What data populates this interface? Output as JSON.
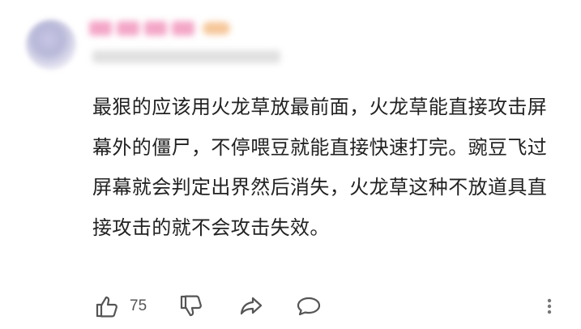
{
  "comment": {
    "text": "最狠的应该用火龙草放最前面，火龙草能直接攻击屏幕外的僵尸，不停喂豆就能直接快速打完。豌豆飞过屏幕就会判定出界然后消失，火龙草这种不放道具直接攻击的就不会攻击失效。",
    "like_count": "75"
  },
  "icons": {
    "like": "thumbs-up-icon",
    "dislike": "thumbs-down-icon",
    "share": "share-icon",
    "reply": "comment-icon",
    "more": "more-vertical-icon"
  },
  "colors": {
    "text": "#222222",
    "icon": "#555555"
  }
}
